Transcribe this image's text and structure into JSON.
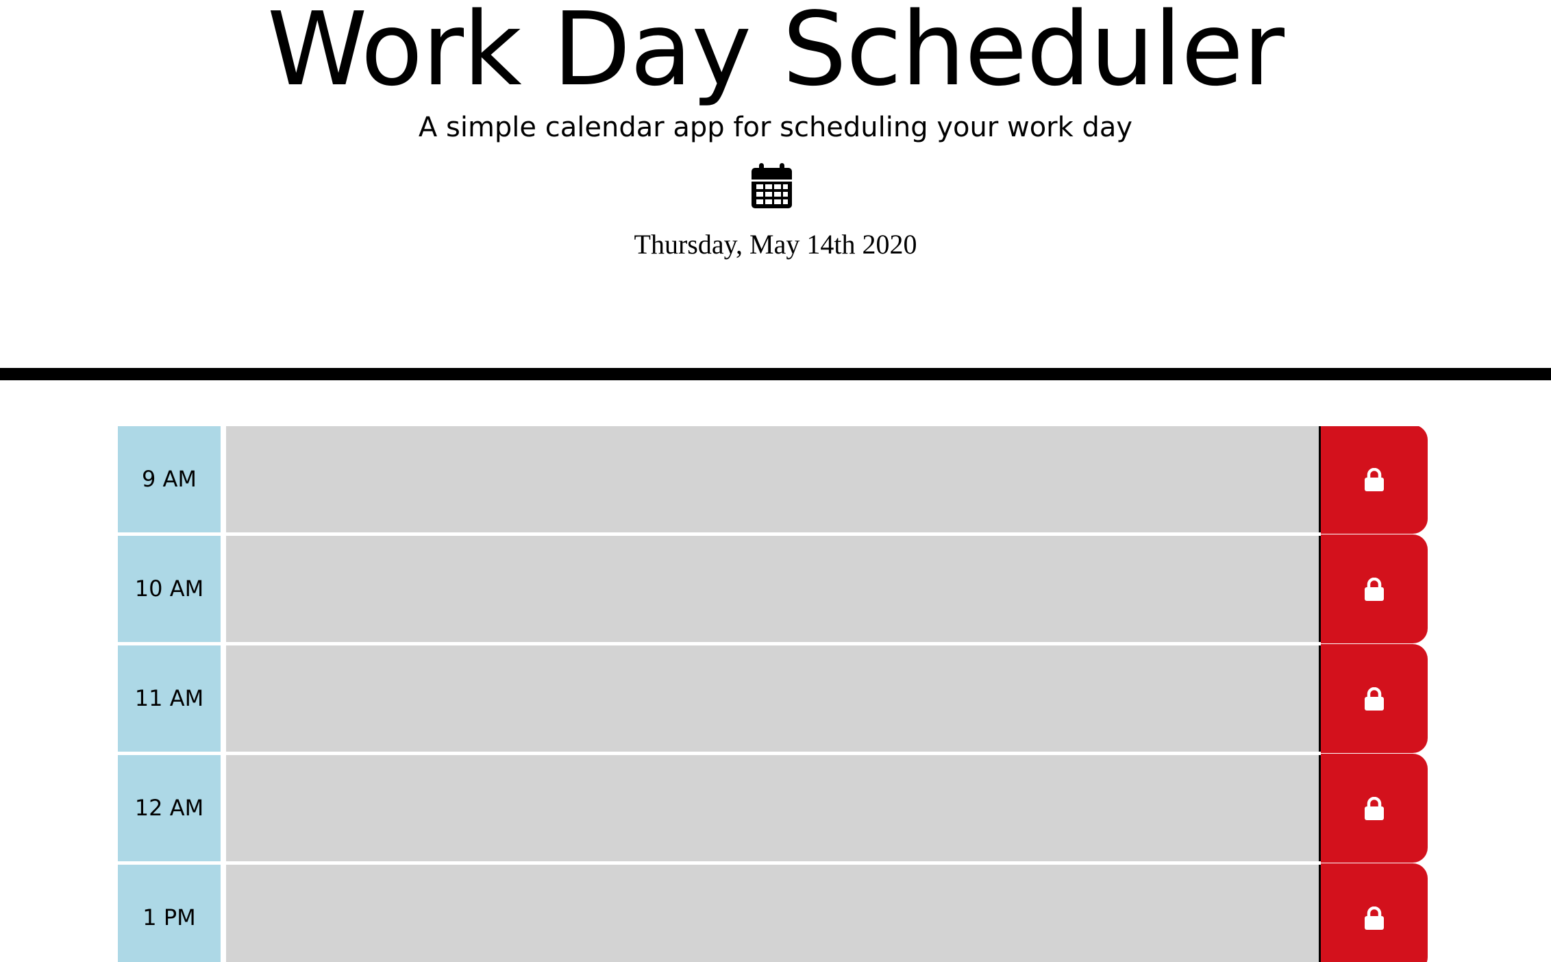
{
  "header": {
    "title": "Work Day Scheduler",
    "subtitle": "A simple calendar app for scheduling your work day",
    "icon": "calendar-icon",
    "date": "Thursday, May 14th 2020"
  },
  "schedule": {
    "rows": [
      {
        "hour": "9 AM",
        "task": "",
        "save_icon": "lock-icon"
      },
      {
        "hour": "10 AM",
        "task": "",
        "save_icon": "lock-icon"
      },
      {
        "hour": "11 AM",
        "task": "",
        "save_icon": "lock-icon"
      },
      {
        "hour": "12 AM",
        "task": "",
        "save_icon": "lock-icon"
      },
      {
        "hour": "1 PM",
        "task": "",
        "save_icon": "lock-icon"
      }
    ]
  },
  "colors": {
    "hour_background": "#add8e6",
    "task_background": "#d3d3d3",
    "save_button": "#d3111c",
    "divider": "#000000"
  }
}
